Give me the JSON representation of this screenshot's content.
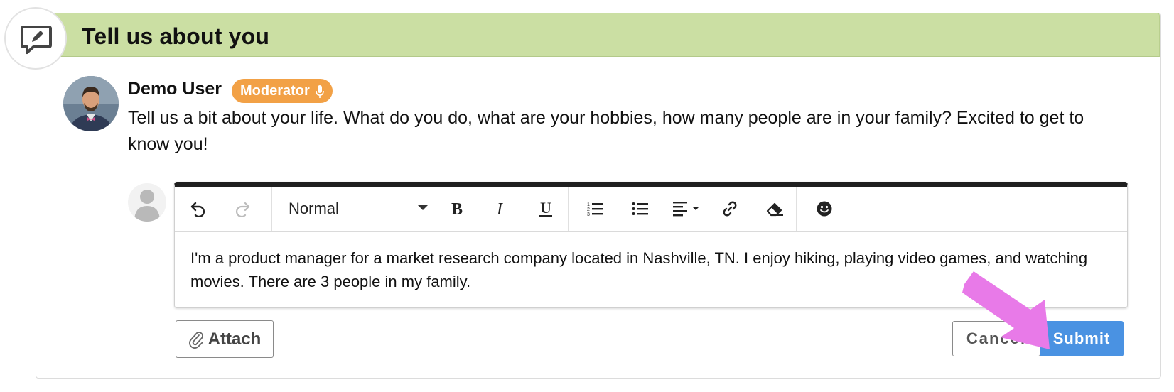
{
  "header": {
    "title": "Tell us about you",
    "icon": "comment-edit-icon",
    "bg_color": "#cbdfa3"
  },
  "post": {
    "author": "Demo User",
    "badge": {
      "label": "Moderator",
      "icon": "microphone-icon",
      "color": "#f2a146"
    },
    "text": "Tell us a bit about your life. What do you do, what are your hobbies, how many people are in your family? Excited to get to know you!"
  },
  "editor": {
    "toolbar": {
      "undo": "undo-icon",
      "redo": "redo-icon",
      "format_value": "Normal",
      "bold": "bold-icon",
      "italic": "italic-icon",
      "underline": "underline-icon",
      "ordered_list": "ordered-list-icon",
      "bullet_list": "bullet-list-icon",
      "align": "align-left-icon",
      "link": "link-icon",
      "clear_format": "eraser-icon",
      "emoji": "emoji-icon"
    },
    "content": "I'm a product manager for a market research company located in Nashville, TN. I enjoy hiking, playing video games, and watching movies. There are 3 people in my family."
  },
  "actions": {
    "attach_label": "Attach",
    "cancel_label": "Cancel",
    "submit_label": "Submit",
    "submit_color": "#4a92e2"
  },
  "annotation": {
    "type": "arrow",
    "color": "#e87ae8",
    "points_to": "Submit"
  }
}
